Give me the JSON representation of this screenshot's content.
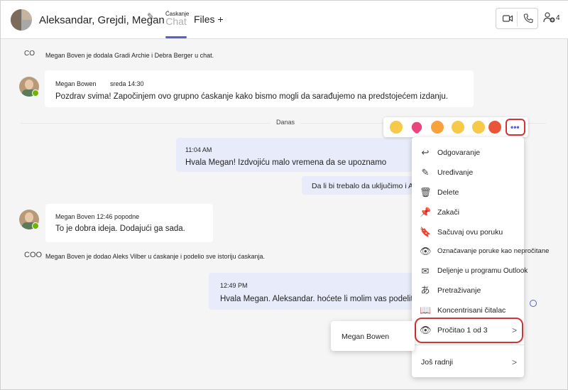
{
  "header": {
    "title": "Aleksandar, Grejdi, Megan",
    "tab_chat_small": "Ćaskanje",
    "tab_chat_ghost": "Chat",
    "tab_files": "Files",
    "tab_add": "+",
    "people_count": "4"
  },
  "system_messages": [
    {
      "icon": "CO",
      "text": "Megan Boven je dodala Gradi Archie i Debra Berger u chat."
    },
    {
      "icon": "COO",
      "text": "Megan Boven je dodao Aleks Vilber u ćaskanje i podelio sve istoriju ćaskanja."
    }
  ],
  "messages": [
    {
      "author": "Megan Bowen",
      "time": "sreda 14:30",
      "text": "Pozdrav svima! Započinjem ovo grupno ćaskanje kako bismo mogli da sarađujemo na predstojećem izdanju."
    },
    {
      "time": "11:04",
      "time_suffix": "AM",
      "text": "Hvala Megan! Izdvojiću malo vremena da se upoznamo"
    },
    {
      "text": "Da li bi trebalo da uključimo i A"
    },
    {
      "author": "Megan Boven 12:46 popodne",
      "text": "To je dobra ideja. Dodajući ga sada."
    },
    {
      "time": "12:49 PM",
      "text": "Hvala Megan. Aleksandar. hoćete li molim vas podelit m"
    }
  ],
  "divider_label": "Danas",
  "reactions": [
    "like",
    "heart",
    "laugh",
    "surprised",
    "sad",
    "angry"
  ],
  "menu": {
    "items": [
      {
        "icon": "reply-icon",
        "glyph": "↩",
        "label": "Odgovaranje"
      },
      {
        "icon": "edit-icon",
        "glyph": "✎",
        "label": "Uređivanje"
      },
      {
        "icon": "delete-icon",
        "glyph": "🗑",
        "label": "Delete"
      },
      {
        "icon": "pin-icon",
        "glyph": "📌",
        "label": "Zakači"
      },
      {
        "icon": "bookmark-icon",
        "glyph": "🔖",
        "label": "Sačuvaj ovu poruku"
      },
      {
        "icon": "unread-icon",
        "glyph": "👁",
        "label": "Označavanje poruke kao nepročitane"
      },
      {
        "icon": "mail-icon",
        "glyph": "✉",
        "label": "Deljenje u programu Outlook"
      },
      {
        "icon": "translate-icon",
        "glyph": "あ",
        "label": "Pretraživanje"
      },
      {
        "icon": "immersive-reader-icon",
        "glyph": "📖",
        "label": "Koncentrisani čitalac"
      },
      {
        "icon": "eye-icon",
        "glyph": "👁",
        "label": "Pročitao 1 od 3"
      },
      {
        "icon": "",
        "glyph": "",
        "label": "Još radnji"
      }
    ]
  },
  "submenu": {
    "label": "Megan Bowen"
  },
  "colors": {
    "accent": "#5b5fc7",
    "highlight": "#d13438",
    "presence": "#6bb700"
  }
}
